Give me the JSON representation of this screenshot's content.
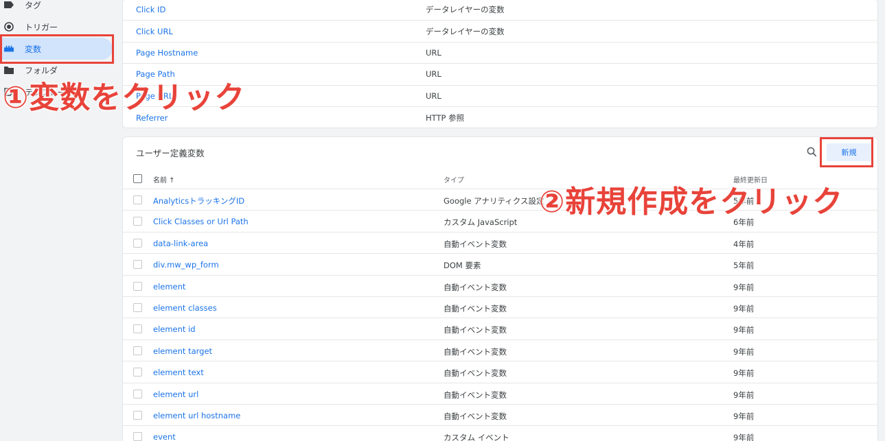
{
  "sidebar": {
    "items": [
      {
        "label": "タグ",
        "icon": "tag-icon"
      },
      {
        "label": "トリガー",
        "icon": "trigger-icon"
      },
      {
        "label": "変数",
        "icon": "variables-icon",
        "active": true
      },
      {
        "label": "フォルダ",
        "icon": "folder-icon"
      },
      {
        "label": "テンプレート",
        "icon": "template-icon"
      }
    ]
  },
  "builtin_variables": {
    "rows": [
      {
        "name": "Click ID",
        "type": "データレイヤーの変数"
      },
      {
        "name": "Click URL",
        "type": "データレイヤーの変数"
      },
      {
        "name": "Page Hostname",
        "type": "URL"
      },
      {
        "name": "Page Path",
        "type": "URL"
      },
      {
        "name": "Page URL",
        "type": "URL"
      },
      {
        "name": "Referrer",
        "type": "HTTP 参照"
      }
    ]
  },
  "user_variables": {
    "title": "ユーザー定義変数",
    "new_button_label": "新規",
    "columns": {
      "name": "名前 ↑",
      "type": "タイプ",
      "updated": "最終更新日"
    },
    "rows": [
      {
        "name": "Analyticsトラッキング​ID",
        "type": "Google アナリティクス設定",
        "updated": "5年前"
      },
      {
        "name": "Click Classes or Url Path",
        "type": "カスタム JavaScript",
        "updated": "6年前"
      },
      {
        "name": "data-link-area",
        "type": "自動イベント変数",
        "updated": "4年前"
      },
      {
        "name": "div.mw_wp_form",
        "type": "DOM 要素",
        "updated": "5年前"
      },
      {
        "name": "element",
        "type": "自動イベント変数",
        "updated": "9年前"
      },
      {
        "name": "element classes",
        "type": "自動イベント変数",
        "updated": "9年前"
      },
      {
        "name": "element id",
        "type": "自動イベント変数",
        "updated": "9年前"
      },
      {
        "name": "element target",
        "type": "自動イベント変数",
        "updated": "9年前"
      },
      {
        "name": "element text",
        "type": "自動イベント変数",
        "updated": "9年前"
      },
      {
        "name": "element url",
        "type": "自動イベント変数",
        "updated": "9年前"
      },
      {
        "name": "element url hostname",
        "type": "自動イベント変数",
        "updated": "9年前"
      },
      {
        "name": "event",
        "type": "カスタム イベント",
        "updated": "9年前"
      }
    ]
  },
  "annotations": {
    "step1": "①変数をクリック",
    "step2": "②新規作成をクリック",
    "color": "#e8433a"
  },
  "colors": {
    "link": "#1a73e8",
    "active_bg": "#d2e3fc",
    "button_bg": "#e8f0fe"
  }
}
